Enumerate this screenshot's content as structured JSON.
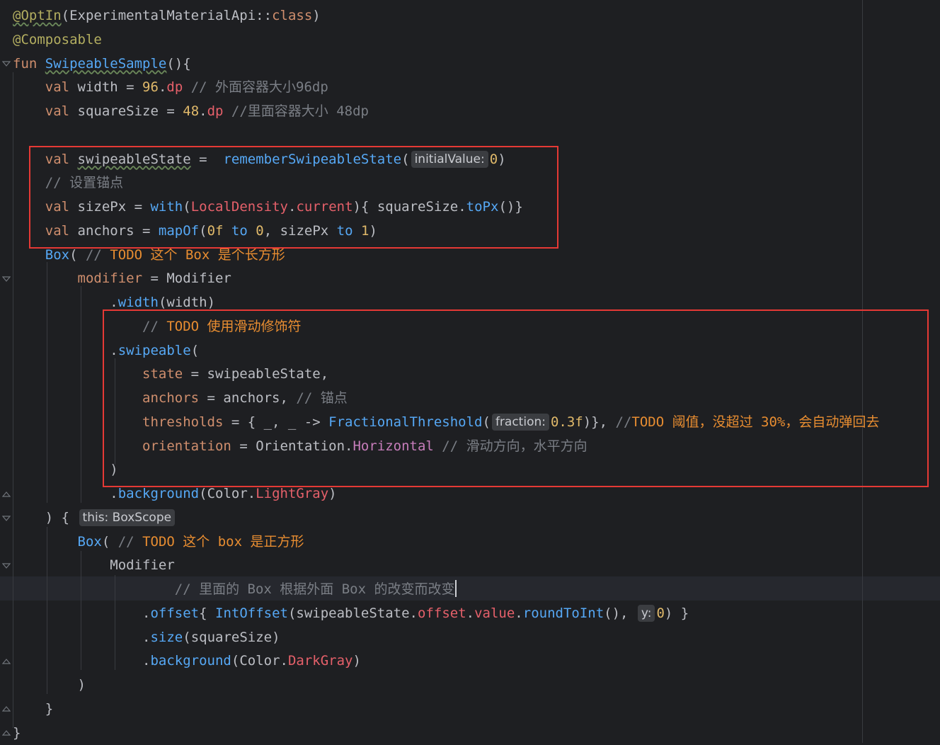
{
  "editor": {
    "lines": [
      {
        "tokens": [
          {
            "t": "@OptIn",
            "c": "annotation warn"
          },
          {
            "t": "(ExperimentalMaterialApi::",
            "c": "ident"
          },
          {
            "t": "class",
            "c": "kw"
          },
          {
            "t": ")",
            "c": "ident"
          }
        ]
      },
      {
        "tokens": [
          {
            "t": "@Composable",
            "c": "annotation"
          }
        ]
      },
      {
        "tokens": [
          {
            "t": "fun ",
            "c": "kw"
          },
          {
            "t": "SwipeableSample",
            "c": "fn warn"
          },
          {
            "t": "(){",
            "c": "ident"
          }
        ]
      },
      {
        "tokens": [
          {
            "t": "    "
          },
          {
            "t": "val ",
            "c": "kw"
          },
          {
            "t": "width = ",
            "c": "ident"
          },
          {
            "t": "96",
            "c": "num-o"
          },
          {
            "t": ".",
            "c": "ident"
          },
          {
            "t": "dp",
            "c": "ext"
          },
          {
            "t": " // 外面容器大小96dp",
            "c": "cmt"
          }
        ]
      },
      {
        "tokens": [
          {
            "t": "    "
          },
          {
            "t": "val ",
            "c": "kw"
          },
          {
            "t": "squareSize = ",
            "c": "ident"
          },
          {
            "t": "48",
            "c": "num-o"
          },
          {
            "t": ".",
            "c": "ident"
          },
          {
            "t": "dp",
            "c": "ext"
          },
          {
            "t": " //里面容器大小 48dp",
            "c": "cmt"
          }
        ]
      },
      {
        "tokens": []
      },
      {
        "tokens": [
          {
            "t": "    "
          },
          {
            "t": "val ",
            "c": "kw"
          },
          {
            "t": "swipeableState",
            "c": "ident warn"
          },
          {
            "t": " =  ",
            "c": "ident"
          },
          {
            "t": "rememberSwipeableState",
            "c": "fn"
          },
          {
            "t": "(",
            "c": "ident"
          },
          {
            "hint": "initialValue:"
          },
          {
            "t": "0",
            "c": "num-o"
          },
          {
            "t": ")",
            "c": "ident"
          }
        ]
      },
      {
        "tokens": [
          {
            "t": "    "
          },
          {
            "t": "// 设置锚点",
            "c": "cmt"
          }
        ]
      },
      {
        "tokens": [
          {
            "t": "    "
          },
          {
            "t": "val ",
            "c": "kw"
          },
          {
            "t": "sizePx = ",
            "c": "ident"
          },
          {
            "t": "with",
            "c": "fn"
          },
          {
            "t": "(",
            "c": "ident"
          },
          {
            "t": "LocalDensity",
            "c": "ext"
          },
          {
            "t": ".",
            "c": "ident"
          },
          {
            "t": "current",
            "c": "ext"
          },
          {
            "t": "){ squareSize.",
            "c": "ident"
          },
          {
            "t": "toPx",
            "c": "fn"
          },
          {
            "t": "()}",
            "c": "ident"
          }
        ]
      },
      {
        "tokens": [
          {
            "t": "    "
          },
          {
            "t": "val ",
            "c": "kw"
          },
          {
            "t": "anchors = ",
            "c": "ident"
          },
          {
            "t": "mapOf",
            "c": "fn"
          },
          {
            "t": "(",
            "c": "ident"
          },
          {
            "t": "0f",
            "c": "num-o"
          },
          {
            "t": " ",
            "c": "ident"
          },
          {
            "t": "to",
            "c": "fn"
          },
          {
            "t": " ",
            "c": "ident"
          },
          {
            "t": "0",
            "c": "num-o"
          },
          {
            "t": ", sizePx ",
            "c": "ident"
          },
          {
            "t": "to",
            "c": "fn"
          },
          {
            "t": " ",
            "c": "ident"
          },
          {
            "t": "1",
            "c": "num-o"
          },
          {
            "t": ")",
            "c": "ident"
          }
        ]
      },
      {
        "tokens": [
          {
            "t": "    "
          },
          {
            "t": "Box",
            "c": "fn"
          },
          {
            "t": "( ",
            "c": "ident"
          },
          {
            "t": "// ",
            "c": "cmt"
          },
          {
            "t": "TODO 这个 Box 是个长方形",
            "c": "todo"
          }
        ]
      },
      {
        "tokens": [
          {
            "t": "        "
          },
          {
            "t": "modifier",
            "c": "kw"
          },
          {
            "t": " = Modifier",
            "c": "ident"
          }
        ]
      },
      {
        "tokens": [
          {
            "t": "            "
          },
          {
            "t": ".",
            "c": "ident"
          },
          {
            "t": "width",
            "c": "fn"
          },
          {
            "t": "(width)",
            "c": "ident"
          }
        ]
      },
      {
        "tokens": [
          {
            "t": "                "
          },
          {
            "t": "// ",
            "c": "cmt"
          },
          {
            "t": "TODO 使用滑动修饰符",
            "c": "todo"
          }
        ]
      },
      {
        "tokens": [
          {
            "t": "            "
          },
          {
            "t": ".",
            "c": "ident"
          },
          {
            "t": "swipeable",
            "c": "fn"
          },
          {
            "t": "(",
            "c": "ident"
          }
        ]
      },
      {
        "tokens": [
          {
            "t": "                "
          },
          {
            "t": "state",
            "c": "kw"
          },
          {
            "t": " = swipeableState,",
            "c": "ident"
          }
        ]
      },
      {
        "tokens": [
          {
            "t": "                "
          },
          {
            "t": "anchors",
            "c": "kw"
          },
          {
            "t": " = anchors, ",
            "c": "ident"
          },
          {
            "t": "// 锚点",
            "c": "cmt"
          }
        ]
      },
      {
        "tokens": [
          {
            "t": "                "
          },
          {
            "t": "thresholds",
            "c": "kw"
          },
          {
            "t": " = { _, _ -> ",
            "c": "ident"
          },
          {
            "t": "FractionalThreshold",
            "c": "fn"
          },
          {
            "t": "(",
            "c": "ident"
          },
          {
            "hint": "fraction:"
          },
          {
            "t": "0.3f",
            "c": "num-o"
          },
          {
            "t": ")}, ",
            "c": "ident"
          },
          {
            "t": "//",
            "c": "cmt"
          },
          {
            "t": "TODO 阈值，没超过 30%，会自动弹回去",
            "c": "todo"
          }
        ]
      },
      {
        "tokens": [
          {
            "t": "                "
          },
          {
            "t": "orientation",
            "c": "kw"
          },
          {
            "t": " = Orientation.",
            "c": "ident"
          },
          {
            "t": "Horizontal",
            "c": "prop"
          },
          {
            "t": " // 滑动方向，水平方向",
            "c": "cmt"
          }
        ]
      },
      {
        "tokens": [
          {
            "t": "            "
          },
          {
            "t": ")",
            "c": "ident"
          }
        ]
      },
      {
        "tokens": [
          {
            "t": "            "
          },
          {
            "t": ".",
            "c": "ident"
          },
          {
            "t": "background",
            "c": "fn"
          },
          {
            "t": "(Color.",
            "c": "ident"
          },
          {
            "t": "LightGray",
            "c": "ext"
          },
          {
            "t": ")",
            "c": "ident"
          }
        ]
      },
      {
        "tokens": [
          {
            "t": "    "
          },
          {
            "t": ") { ",
            "c": "ident"
          },
          {
            "hint": "this: BoxScope"
          }
        ]
      },
      {
        "tokens": [
          {
            "t": "        "
          },
          {
            "t": "Box",
            "c": "fn"
          },
          {
            "t": "( ",
            "c": "ident"
          },
          {
            "t": "// ",
            "c": "cmt"
          },
          {
            "t": "TODO 这个 box 是正方形",
            "c": "todo"
          }
        ]
      },
      {
        "tokens": [
          {
            "t": "            "
          },
          {
            "t": "Modifier",
            "c": "ident"
          }
        ]
      },
      {
        "tokens": [
          {
            "t": "                    "
          },
          {
            "t": "// 里面的 Box 根据外面 Box 的改变而改变",
            "c": "cmt"
          },
          {
            "caret": true
          }
        ]
      },
      {
        "tokens": [
          {
            "t": "                "
          },
          {
            "t": ".",
            "c": "ident"
          },
          {
            "t": "offset",
            "c": "fn"
          },
          {
            "t": "{ ",
            "c": "ident"
          },
          {
            "t": "IntOffset",
            "c": "fn"
          },
          {
            "t": "(swipeableState.",
            "c": "ident"
          },
          {
            "t": "offset",
            "c": "ext"
          },
          {
            "t": ".",
            "c": "ident"
          },
          {
            "t": "value",
            "c": "ext"
          },
          {
            "t": ".",
            "c": "ident"
          },
          {
            "t": "roundToInt",
            "c": "fn"
          },
          {
            "t": "(), ",
            "c": "ident"
          },
          {
            "hint": "y:"
          },
          {
            "t": "0",
            "c": "num-o"
          },
          {
            "t": ") }",
            "c": "ident"
          }
        ]
      },
      {
        "tokens": [
          {
            "t": "                "
          },
          {
            "t": ".",
            "c": "ident"
          },
          {
            "t": "size",
            "c": "fn"
          },
          {
            "t": "(squareSize)",
            "c": "ident"
          }
        ]
      },
      {
        "tokens": [
          {
            "t": "                "
          },
          {
            "t": ".",
            "c": "ident"
          },
          {
            "t": "background",
            "c": "fn"
          },
          {
            "t": "(Color.",
            "c": "ident"
          },
          {
            "t": "DarkGray",
            "c": "ext"
          },
          {
            "t": ")",
            "c": "ident"
          }
        ]
      },
      {
        "tokens": [
          {
            "t": "        "
          },
          {
            "t": ")",
            "c": "ident"
          }
        ]
      },
      {
        "tokens": [
          {
            "t": "    "
          },
          {
            "t": "}",
            "c": "ident"
          }
        ]
      },
      {
        "tokens": [
          {
            "t": "}",
            "c": "ident"
          }
        ]
      }
    ]
  },
  "colors": {
    "background": "#1e1f22",
    "highlight_box": "#e53935",
    "keyword": "#cf8e6d",
    "function": "#56a8f5",
    "comment": "#7a7e85",
    "todo": "#e88d31",
    "annotation": "#b3ae60"
  }
}
